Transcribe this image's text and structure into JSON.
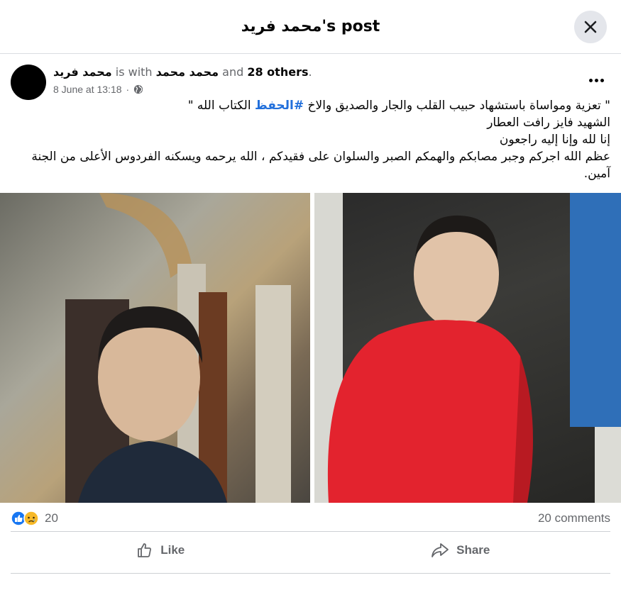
{
  "dialog": {
    "title": "محمد فريد's post"
  },
  "post": {
    "author": "محمد فريد",
    "with_text": "is with",
    "tagged": "محمد محمد",
    "and_text": "and",
    "others": "28 others",
    "date": "8 June at 13:18",
    "text_lines": [
      "\" تعزية ومواساة باستشهاد حبيب القلب والجار والصديق والاخ",
      "#الحفظ",
      "الكتاب الله \"",
      "الشهيد فايز رافت العطار",
      "إنا لله وإنا إليه راجعون",
      "عظم الله اجركم وجبر مصابكم والهمكم الصبر والسلوان على فقيدكم ، الله يرحمه ويسكنه الفردوس الأعلى من الجنة آمين."
    ]
  },
  "stats": {
    "reactions_count": "20",
    "comments": "20 comments"
  },
  "actions": {
    "like": "Like",
    "share": "Share"
  },
  "icons": {
    "close": "close-icon",
    "more": "more-icon",
    "globe": "globe-icon",
    "like": "like-icon",
    "sad": "sad-icon",
    "share": "share-icon"
  },
  "colors": {
    "link": "#216fdb",
    "like_blue": "#1877f2",
    "sad_yellow": "#f7b928"
  }
}
